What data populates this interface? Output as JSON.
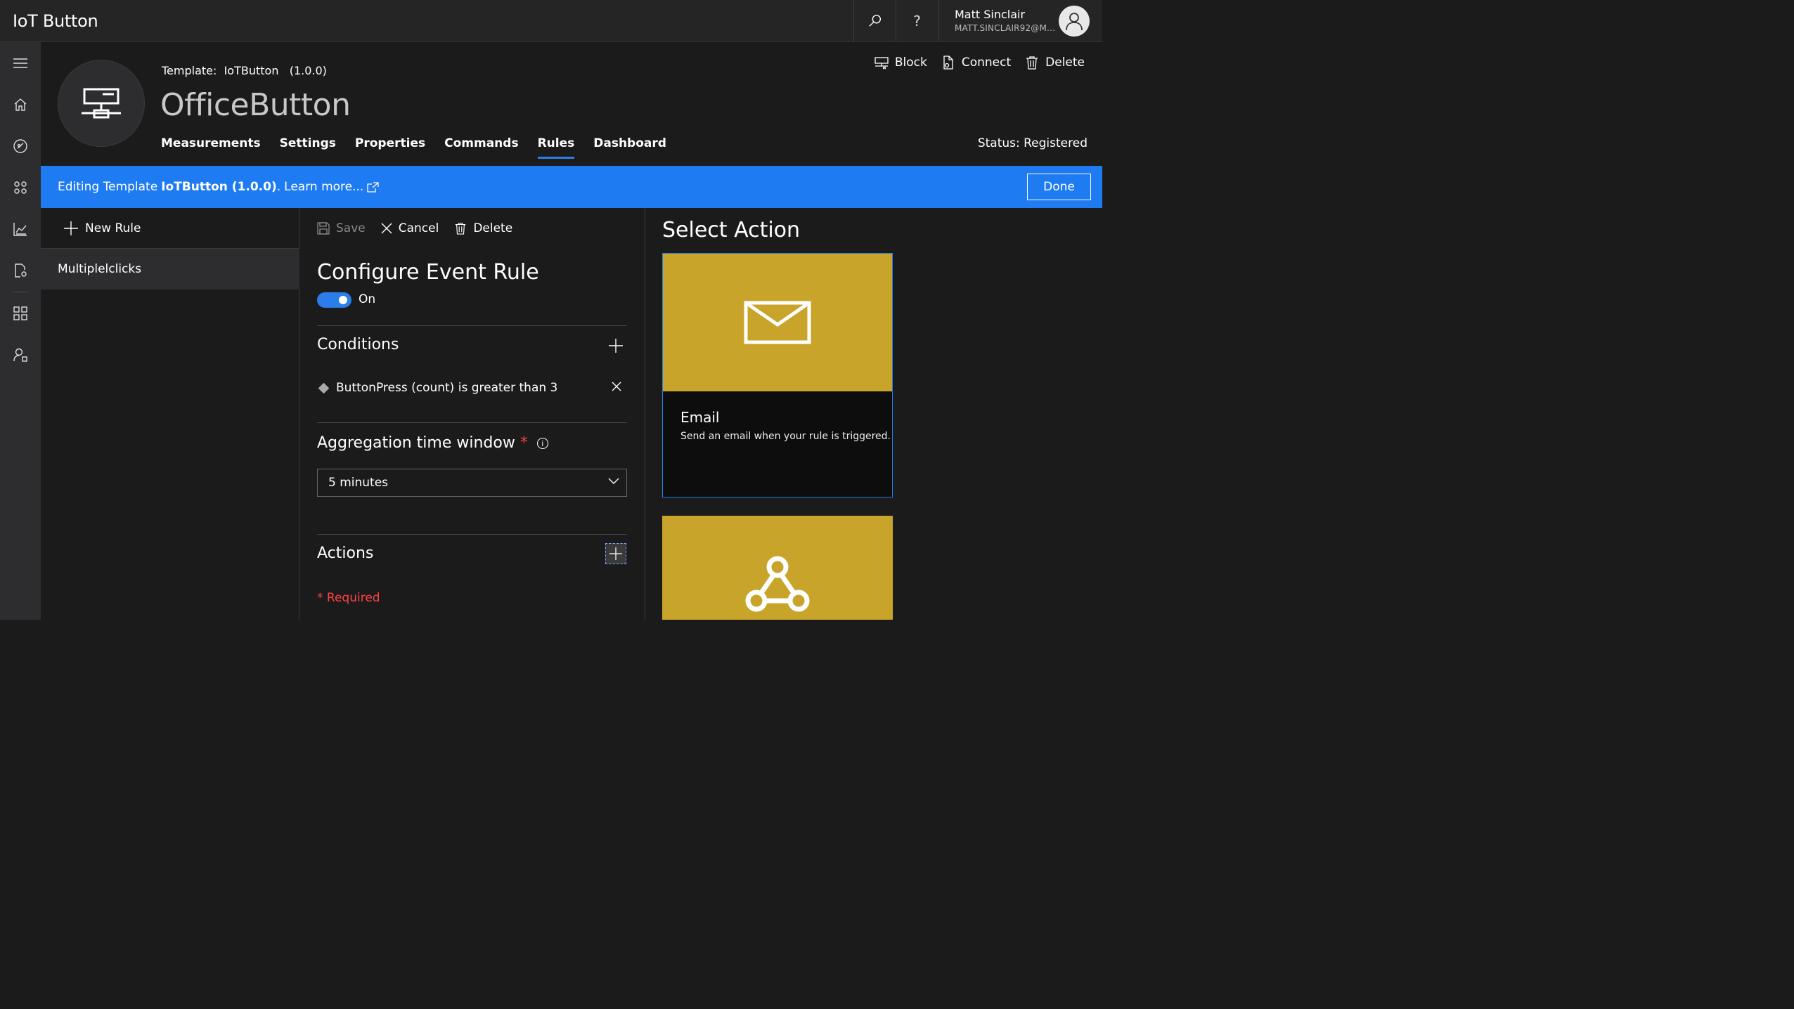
{
  "app": {
    "title": "IoT Button"
  },
  "user": {
    "name": "Matt Sinclair",
    "email": "MATT.SINCLAIR92@M..."
  },
  "topbar": {
    "search_icon": "search-icon",
    "help_label": "?"
  },
  "device": {
    "template_label": "Template:",
    "template_name": "IoTButton",
    "template_version": "(1.0.0)",
    "name": "OfficeButton",
    "status": "Status: Registered"
  },
  "header_actions": {
    "block": "Block",
    "connect": "Connect",
    "delete": "Delete"
  },
  "tabs": [
    {
      "label": "Measurements",
      "active": false
    },
    {
      "label": "Settings",
      "active": false
    },
    {
      "label": "Properties",
      "active": false
    },
    {
      "label": "Commands",
      "active": false
    },
    {
      "label": "Rules",
      "active": true
    },
    {
      "label": "Dashboard",
      "active": false
    }
  ],
  "banner": {
    "prefix": "Editing Template",
    "template": "IoTButton (1.0.0)",
    "suffix": ".",
    "learn_more": "Learn more...",
    "done": "Done"
  },
  "rules": {
    "new_rule": "New Rule",
    "items": [
      "Multiplelclicks"
    ]
  },
  "config": {
    "save": "Save",
    "cancel": "Cancel",
    "delete": "Delete",
    "title": "Configure Event Rule",
    "toggle_label": "On",
    "conditions_title": "Conditions",
    "condition_text": "ButtonPress (count) is greater than 3",
    "aggregation_title": "Aggregation time window",
    "aggregation_value": "5 minutes",
    "actions_title": "Actions",
    "required_note": "Required",
    "required_star": "*"
  },
  "action_panel": {
    "title": "Select Action",
    "cards": [
      {
        "name": "Email",
        "description": "Send an email when your rule is triggered.",
        "icon": "envelope-icon"
      },
      {
        "name": "",
        "description": "",
        "icon": "webhook-icon"
      }
    ]
  },
  "colors": {
    "accent": "#1f7bf2",
    "card": "#c9a42a",
    "required": "#ff4343"
  }
}
